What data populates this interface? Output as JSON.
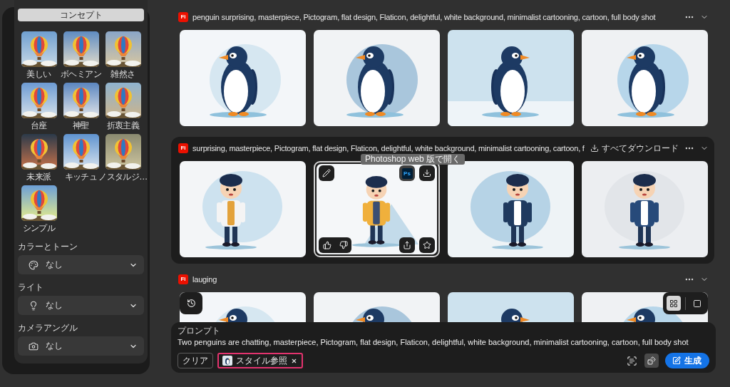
{
  "sidebar": {
    "category": "コンセプト",
    "styles": [
      {
        "label": "美しい"
      },
      {
        "label": "ボヘミアン"
      },
      {
        "label": "雑然さ"
      },
      {
        "label": "台座"
      },
      {
        "label": "神聖"
      },
      {
        "label": "折衷主義"
      },
      {
        "label": "未来派"
      },
      {
        "label": "キッチュ"
      },
      {
        "label": "ノスタルジ…"
      },
      {
        "label": "シンプル"
      }
    ],
    "settings": [
      {
        "kind": "palette",
        "label": "カラーとトーン",
        "value": "なし"
      },
      {
        "kind": "light",
        "label": "ライト",
        "value": "なし"
      },
      {
        "kind": "camera",
        "label": "カメラアングル",
        "value": "なし"
      }
    ]
  },
  "generations": [
    {
      "badge": "Fi",
      "prompt": "penguin surprising, masterpiece, Pictogram, flat design, Flaticon, delightful, white background, minimalist cartooning, cartoon, full body shot",
      "hovered": false,
      "images": [
        {
          "kind": "penguin",
          "hovered": false
        },
        {
          "kind": "penguin",
          "hovered": false
        },
        {
          "kind": "penguin",
          "hovered": false
        },
        {
          "kind": "penguin",
          "hovered": false
        }
      ]
    },
    {
      "badge": "Fi",
      "prompt": "surprising, masterpiece, Pictogram, flat design, Flaticon, delightful, white background, minimalist cartooning, cartoon, f",
      "hovered": true,
      "download_all": "すべてダウンロード",
      "images": [
        {
          "kind": "boy",
          "hovered": false
        },
        {
          "kind": "boy",
          "hovered": true,
          "tooltip": "Photoshop web 版で開く",
          "ps_label": "Ps"
        },
        {
          "kind": "boy",
          "hovered": false
        },
        {
          "kind": "boy",
          "hovered": false
        }
      ]
    },
    {
      "badge": "Fi",
      "prompt": "lauging",
      "hovered": false,
      "images": [
        {
          "kind": "penguin",
          "hovered": false
        },
        {
          "kind": "penguin",
          "hovered": false
        },
        {
          "kind": "penguin",
          "hovered": false
        },
        {
          "kind": "penguin",
          "hovered": false
        }
      ]
    }
  ],
  "view_modes": [
    {
      "kind": "grid",
      "selected": true
    },
    {
      "kind": "single",
      "selected": false
    }
  ],
  "prompt_panel": {
    "label": "プロンプト",
    "text": "Two penguins are chatting, masterpiece, Pictogram, flat design, Flaticon, delightful, white background, minimalist cartooning, cartoon, full body shot",
    "clear_button": "クリア",
    "style_reference": {
      "label": "スタイル参照",
      "highlighted": true
    },
    "generate_button": "生成"
  }
}
